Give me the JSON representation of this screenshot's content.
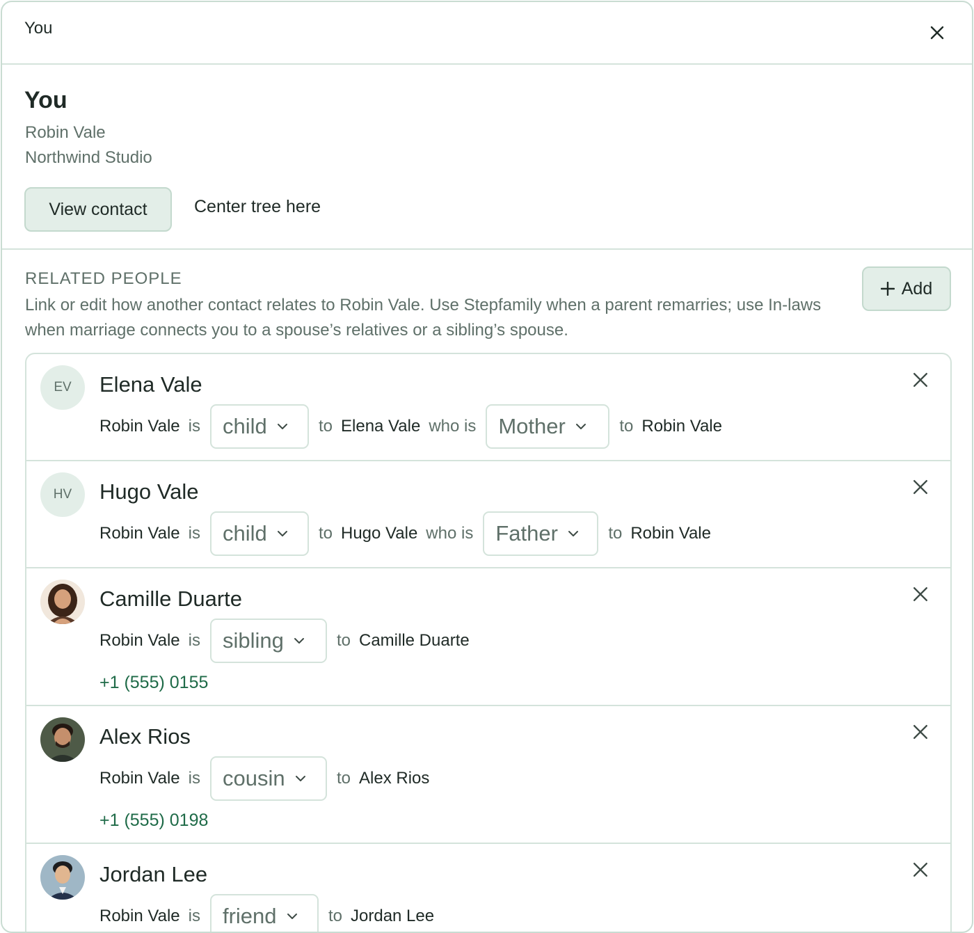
{
  "header": {
    "title": "You"
  },
  "profile": {
    "heading": "You",
    "name": "Robin Vale",
    "company": "Northwind Studio",
    "view_contact_label": "View contact",
    "center_tree_label": "Center tree here"
  },
  "related": {
    "heading": "RELATED PEOPLE",
    "description": "Link or edit how another contact relates to Robin Vale. Use Stepfamily when a parent remarries; use In-laws when marriage connects you to a spouse’s relatives or a sibling’s spouse.",
    "add_label": "Add",
    "word_is": "is",
    "word_to": "to",
    "word_who_is": "who is",
    "self_name": "Robin Vale"
  },
  "people": [
    {
      "initials": "EV",
      "name": "Elena Vale",
      "relation": "child",
      "reciprocal": "Mother"
    },
    {
      "initials": "HV",
      "name": "Hugo Vale",
      "relation": "child",
      "reciprocal": "Father"
    },
    {
      "initials": "",
      "name": "Camille Duarte",
      "relation": "sibling",
      "phone": "+1 (555) 0155"
    },
    {
      "initials": "",
      "name": "Alex Rios",
      "relation": "cousin",
      "phone": "+1 (555) 0198"
    },
    {
      "initials": "",
      "name": "Jordan Lee",
      "relation": "friend"
    }
  ],
  "colors": {
    "accent": "#e3eee8",
    "border": "#d4e3db",
    "phone": "#1f6b48",
    "muted": "#5f7069"
  }
}
